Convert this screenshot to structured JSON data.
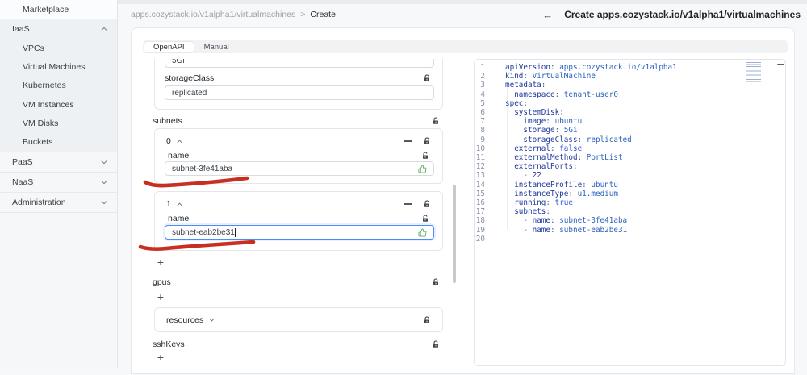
{
  "sidebar": {
    "items": [
      {
        "id": "marketplace",
        "label": "Marketplace",
        "type": "item"
      },
      {
        "id": "iaas",
        "label": "IaaS",
        "type": "group",
        "expanded": true,
        "children": [
          {
            "id": "vpcs",
            "label": "VPCs"
          },
          {
            "id": "virtual-machines",
            "label": "Virtual Machines"
          },
          {
            "id": "kubernetes",
            "label": "Kubernetes"
          },
          {
            "id": "vm-instances",
            "label": "VM Instances"
          },
          {
            "id": "vm-disks",
            "label": "VM Disks"
          },
          {
            "id": "buckets",
            "label": "Buckets"
          }
        ]
      },
      {
        "id": "paas",
        "label": "PaaS",
        "type": "group",
        "expanded": false,
        "children": []
      },
      {
        "id": "naas",
        "label": "NaaS",
        "type": "group",
        "expanded": false,
        "children": []
      },
      {
        "id": "administration",
        "label": "Administration",
        "type": "group",
        "expanded": false,
        "children": []
      }
    ]
  },
  "breadcrumb": {
    "path": "apps.cozystack.io/v1alpha1/virtualmachines",
    "separator": ">",
    "current": "Create"
  },
  "header": {
    "back": "←",
    "title": "Create apps.cozystack.io/v1alpha1/virtualmachines"
  },
  "tabs": {
    "items": [
      {
        "label": "OpenAPI",
        "active": true
      },
      {
        "label": "Manual",
        "active": false
      }
    ]
  },
  "form": {
    "storage_value": "5Gi",
    "storageClass": {
      "label": "storageClass",
      "value": "replicated"
    },
    "subnets": {
      "label": "subnets",
      "add": "+",
      "items": [
        {
          "index": "0",
          "field_label": "name",
          "value": "subnet-3fe41aba",
          "focused": false
        },
        {
          "index": "1",
          "field_label": "name",
          "value": "subnet-eab2be31",
          "focused": true
        }
      ]
    },
    "gpus": {
      "label": "gpus",
      "add": "+"
    },
    "resources": {
      "label": "resources"
    },
    "sshKeys": {
      "label": "sshKeys",
      "add": "+"
    }
  },
  "editor": {
    "lines": [
      {
        "n": "1",
        "segs": [
          [
            "key",
            "apiVersion"
          ],
          [
            "pun",
            ": "
          ],
          [
            "str",
            "apps.cozystack.io/v1alpha1"
          ]
        ]
      },
      {
        "n": "2",
        "segs": [
          [
            "key",
            "kind"
          ],
          [
            "pun",
            ": "
          ],
          [
            "str",
            "VirtualMachine"
          ]
        ]
      },
      {
        "n": "3",
        "segs": [
          [
            "key",
            "metadata"
          ],
          [
            "pun",
            ":"
          ]
        ]
      },
      {
        "n": "4",
        "segs": [
          [
            "pun",
            "  "
          ],
          [
            "key",
            "namespace"
          ],
          [
            "pun",
            ": "
          ],
          [
            "str",
            "tenant-user0"
          ]
        ]
      },
      {
        "n": "5",
        "segs": [
          [
            "key",
            "spec"
          ],
          [
            "pun",
            ":"
          ]
        ]
      },
      {
        "n": "6",
        "segs": [
          [
            "pun",
            "  "
          ],
          [
            "key",
            "systemDisk"
          ],
          [
            "pun",
            ":"
          ]
        ]
      },
      {
        "n": "7",
        "segs": [
          [
            "pun",
            "    "
          ],
          [
            "key",
            "image"
          ],
          [
            "pun",
            ": "
          ],
          [
            "str",
            "ubuntu"
          ]
        ]
      },
      {
        "n": "8",
        "segs": [
          [
            "pun",
            "    "
          ],
          [
            "key",
            "storage"
          ],
          [
            "pun",
            ": "
          ],
          [
            "str",
            "5Gi"
          ]
        ]
      },
      {
        "n": "9",
        "segs": [
          [
            "pun",
            "    "
          ],
          [
            "key",
            "storageClass"
          ],
          [
            "pun",
            ": "
          ],
          [
            "str",
            "replicated"
          ]
        ]
      },
      {
        "n": "10",
        "segs": [
          [
            "pun",
            "  "
          ],
          [
            "key",
            "external"
          ],
          [
            "pun",
            ": "
          ],
          [
            "bool",
            "false"
          ]
        ]
      },
      {
        "n": "11",
        "segs": [
          [
            "pun",
            "  "
          ],
          [
            "key",
            "externalMethod"
          ],
          [
            "pun",
            ": "
          ],
          [
            "str",
            "PortList"
          ]
        ]
      },
      {
        "n": "12",
        "segs": [
          [
            "pun",
            "  "
          ],
          [
            "key",
            "externalPorts"
          ],
          [
            "pun",
            ":"
          ]
        ]
      },
      {
        "n": "13",
        "segs": [
          [
            "pun",
            "    - "
          ],
          [
            "num",
            "22"
          ]
        ]
      },
      {
        "n": "14",
        "segs": [
          [
            "pun",
            "  "
          ],
          [
            "key",
            "instanceProfile"
          ],
          [
            "pun",
            ": "
          ],
          [
            "str",
            "ubuntu"
          ]
        ]
      },
      {
        "n": "15",
        "segs": [
          [
            "pun",
            "  "
          ],
          [
            "key",
            "instanceType"
          ],
          [
            "pun",
            ": "
          ],
          [
            "str",
            "u1.medium"
          ]
        ]
      },
      {
        "n": "16",
        "segs": [
          [
            "pun",
            "  "
          ],
          [
            "key",
            "running"
          ],
          [
            "pun",
            ": "
          ],
          [
            "bool",
            "true"
          ]
        ]
      },
      {
        "n": "17",
        "segs": [
          [
            "pun",
            "  "
          ],
          [
            "key",
            "subnets"
          ],
          [
            "pun",
            ":"
          ]
        ]
      },
      {
        "n": "18",
        "segs": [
          [
            "pun",
            "    - "
          ],
          [
            "key",
            "name"
          ],
          [
            "pun",
            ": "
          ],
          [
            "str",
            "subnet-3fe41aba"
          ]
        ]
      },
      {
        "n": "19",
        "segs": [
          [
            "pun",
            "    - "
          ],
          [
            "key",
            "name"
          ],
          [
            "pun",
            ": "
          ],
          [
            "str",
            "subnet-eab2be31"
          ]
        ]
      },
      {
        "n": "20",
        "segs": []
      }
    ]
  },
  "colors": {
    "focus_blue": "#4a8df8",
    "valid_green": "#5cae63",
    "annotation_red": "#c92f21",
    "code_key": "#21399b",
    "code_str": "#2a63bd",
    "code_bool": "#2f54e0",
    "code_num": "#21399b",
    "code_pun": "#5a6178",
    "line_number": "#8792a3"
  }
}
